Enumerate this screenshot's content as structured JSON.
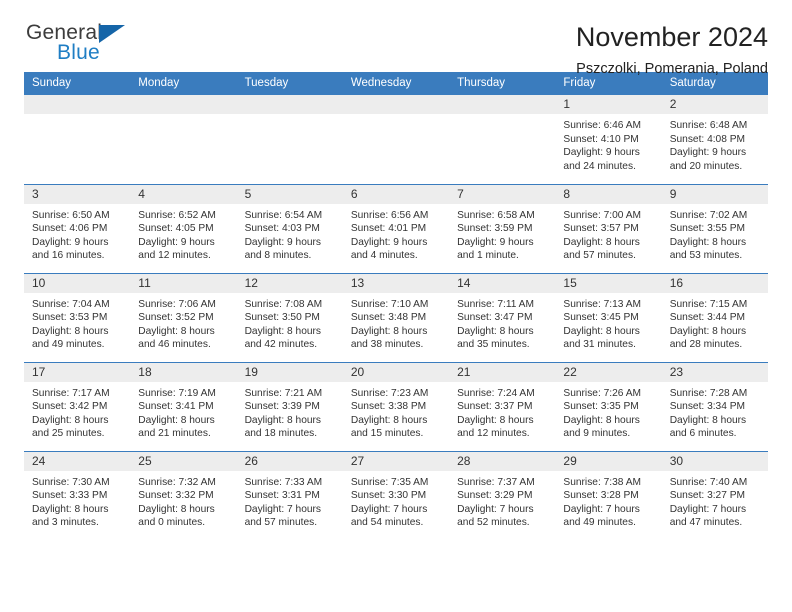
{
  "brand": {
    "name_top": "General",
    "name_bottom": "Blue",
    "accent_color": "#1f7ec4",
    "triangle_color": "#1565a8"
  },
  "header": {
    "title": "November 2024",
    "subtitle": "Pszczolki, Pomerania, Poland"
  },
  "theme": {
    "header_bg": "#3a7cbe",
    "daynum_bg": "#ededed",
    "cell_bg": "#ffffff",
    "text": "#333333"
  },
  "weekdays": [
    "Sunday",
    "Monday",
    "Tuesday",
    "Wednesday",
    "Thursday",
    "Friday",
    "Saturday"
  ],
  "weeks": [
    [
      {
        "day": "",
        "blank": true
      },
      {
        "day": "",
        "blank": true
      },
      {
        "day": "",
        "blank": true
      },
      {
        "day": "",
        "blank": true
      },
      {
        "day": "",
        "blank": true
      },
      {
        "day": "1",
        "sunrise": "Sunrise: 6:46 AM",
        "sunset": "Sunset: 4:10 PM",
        "daylight1": "Daylight: 9 hours",
        "daylight2": "and 24 minutes."
      },
      {
        "day": "2",
        "sunrise": "Sunrise: 6:48 AM",
        "sunset": "Sunset: 4:08 PM",
        "daylight1": "Daylight: 9 hours",
        "daylight2": "and 20 minutes."
      }
    ],
    [
      {
        "day": "3",
        "sunrise": "Sunrise: 6:50 AM",
        "sunset": "Sunset: 4:06 PM",
        "daylight1": "Daylight: 9 hours",
        "daylight2": "and 16 minutes."
      },
      {
        "day": "4",
        "sunrise": "Sunrise: 6:52 AM",
        "sunset": "Sunset: 4:05 PM",
        "daylight1": "Daylight: 9 hours",
        "daylight2": "and 12 minutes."
      },
      {
        "day": "5",
        "sunrise": "Sunrise: 6:54 AM",
        "sunset": "Sunset: 4:03 PM",
        "daylight1": "Daylight: 9 hours",
        "daylight2": "and 8 minutes."
      },
      {
        "day": "6",
        "sunrise": "Sunrise: 6:56 AM",
        "sunset": "Sunset: 4:01 PM",
        "daylight1": "Daylight: 9 hours",
        "daylight2": "and 4 minutes."
      },
      {
        "day": "7",
        "sunrise": "Sunrise: 6:58 AM",
        "sunset": "Sunset: 3:59 PM",
        "daylight1": "Daylight: 9 hours",
        "daylight2": "and 1 minute."
      },
      {
        "day": "8",
        "sunrise": "Sunrise: 7:00 AM",
        "sunset": "Sunset: 3:57 PM",
        "daylight1": "Daylight: 8 hours",
        "daylight2": "and 57 minutes."
      },
      {
        "day": "9",
        "sunrise": "Sunrise: 7:02 AM",
        "sunset": "Sunset: 3:55 PM",
        "daylight1": "Daylight: 8 hours",
        "daylight2": "and 53 minutes."
      }
    ],
    [
      {
        "day": "10",
        "sunrise": "Sunrise: 7:04 AM",
        "sunset": "Sunset: 3:53 PM",
        "daylight1": "Daylight: 8 hours",
        "daylight2": "and 49 minutes."
      },
      {
        "day": "11",
        "sunrise": "Sunrise: 7:06 AM",
        "sunset": "Sunset: 3:52 PM",
        "daylight1": "Daylight: 8 hours",
        "daylight2": "and 46 minutes."
      },
      {
        "day": "12",
        "sunrise": "Sunrise: 7:08 AM",
        "sunset": "Sunset: 3:50 PM",
        "daylight1": "Daylight: 8 hours",
        "daylight2": "and 42 minutes."
      },
      {
        "day": "13",
        "sunrise": "Sunrise: 7:10 AM",
        "sunset": "Sunset: 3:48 PM",
        "daylight1": "Daylight: 8 hours",
        "daylight2": "and 38 minutes."
      },
      {
        "day": "14",
        "sunrise": "Sunrise: 7:11 AM",
        "sunset": "Sunset: 3:47 PM",
        "daylight1": "Daylight: 8 hours",
        "daylight2": "and 35 minutes."
      },
      {
        "day": "15",
        "sunrise": "Sunrise: 7:13 AM",
        "sunset": "Sunset: 3:45 PM",
        "daylight1": "Daylight: 8 hours",
        "daylight2": "and 31 minutes."
      },
      {
        "day": "16",
        "sunrise": "Sunrise: 7:15 AM",
        "sunset": "Sunset: 3:44 PM",
        "daylight1": "Daylight: 8 hours",
        "daylight2": "and 28 minutes."
      }
    ],
    [
      {
        "day": "17",
        "sunrise": "Sunrise: 7:17 AM",
        "sunset": "Sunset: 3:42 PM",
        "daylight1": "Daylight: 8 hours",
        "daylight2": "and 25 minutes."
      },
      {
        "day": "18",
        "sunrise": "Sunrise: 7:19 AM",
        "sunset": "Sunset: 3:41 PM",
        "daylight1": "Daylight: 8 hours",
        "daylight2": "and 21 minutes."
      },
      {
        "day": "19",
        "sunrise": "Sunrise: 7:21 AM",
        "sunset": "Sunset: 3:39 PM",
        "daylight1": "Daylight: 8 hours",
        "daylight2": "and 18 minutes."
      },
      {
        "day": "20",
        "sunrise": "Sunrise: 7:23 AM",
        "sunset": "Sunset: 3:38 PM",
        "daylight1": "Daylight: 8 hours",
        "daylight2": "and 15 minutes."
      },
      {
        "day": "21",
        "sunrise": "Sunrise: 7:24 AM",
        "sunset": "Sunset: 3:37 PM",
        "daylight1": "Daylight: 8 hours",
        "daylight2": "and 12 minutes."
      },
      {
        "day": "22",
        "sunrise": "Sunrise: 7:26 AM",
        "sunset": "Sunset: 3:35 PM",
        "daylight1": "Daylight: 8 hours",
        "daylight2": "and 9 minutes."
      },
      {
        "day": "23",
        "sunrise": "Sunrise: 7:28 AM",
        "sunset": "Sunset: 3:34 PM",
        "daylight1": "Daylight: 8 hours",
        "daylight2": "and 6 minutes."
      }
    ],
    [
      {
        "day": "24",
        "sunrise": "Sunrise: 7:30 AM",
        "sunset": "Sunset: 3:33 PM",
        "daylight1": "Daylight: 8 hours",
        "daylight2": "and 3 minutes."
      },
      {
        "day": "25",
        "sunrise": "Sunrise: 7:32 AM",
        "sunset": "Sunset: 3:32 PM",
        "daylight1": "Daylight: 8 hours",
        "daylight2": "and 0 minutes."
      },
      {
        "day": "26",
        "sunrise": "Sunrise: 7:33 AM",
        "sunset": "Sunset: 3:31 PM",
        "daylight1": "Daylight: 7 hours",
        "daylight2": "and 57 minutes."
      },
      {
        "day": "27",
        "sunrise": "Sunrise: 7:35 AM",
        "sunset": "Sunset: 3:30 PM",
        "daylight1": "Daylight: 7 hours",
        "daylight2": "and 54 minutes."
      },
      {
        "day": "28",
        "sunrise": "Sunrise: 7:37 AM",
        "sunset": "Sunset: 3:29 PM",
        "daylight1": "Daylight: 7 hours",
        "daylight2": "and 52 minutes."
      },
      {
        "day": "29",
        "sunrise": "Sunrise: 7:38 AM",
        "sunset": "Sunset: 3:28 PM",
        "daylight1": "Daylight: 7 hours",
        "daylight2": "and 49 minutes."
      },
      {
        "day": "30",
        "sunrise": "Sunrise: 7:40 AM",
        "sunset": "Sunset: 3:27 PM",
        "daylight1": "Daylight: 7 hours",
        "daylight2": "and 47 minutes."
      }
    ]
  ]
}
